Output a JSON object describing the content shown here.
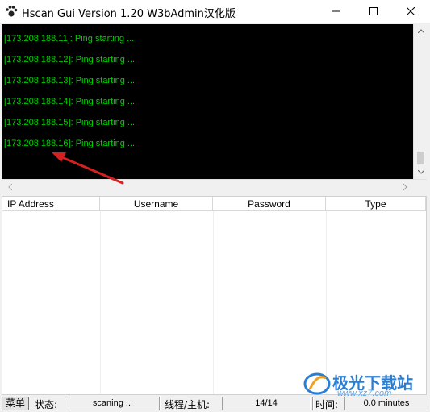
{
  "window": {
    "title": "Hscan Gui Version 1.20 W3bAdmin汉化版",
    "icon": "paw-icon"
  },
  "console": {
    "lines": [
      "[173.208.188.11]: Ping starting ...",
      "[173.208.188.12]: Ping starting ...",
      "[173.208.188.13]: Ping starting ...",
      "[173.208.188.14]: Ping starting ...",
      "[173.208.188.15]: Ping starting ...",
      "[173.208.188.16]: Ping starting ..."
    ],
    "text_color": "#00d000",
    "background": "#000000"
  },
  "results_table": {
    "columns": [
      "IP Address",
      "Username",
      "Password",
      "Type"
    ],
    "rows": []
  },
  "statusbar": {
    "menu_button": "菜单",
    "status_label": "状态:",
    "status_value": "scaning ...",
    "threads_label": "线程/主机:",
    "threads_value": "14/14",
    "time_label": "时间:",
    "time_value": "0.0 minutes"
  },
  "watermark": {
    "text": "极光下载站",
    "url": "www.xz7.com"
  },
  "colors": {
    "annotation_arrow": "#d42020",
    "watermark": "#2a7fd4"
  }
}
